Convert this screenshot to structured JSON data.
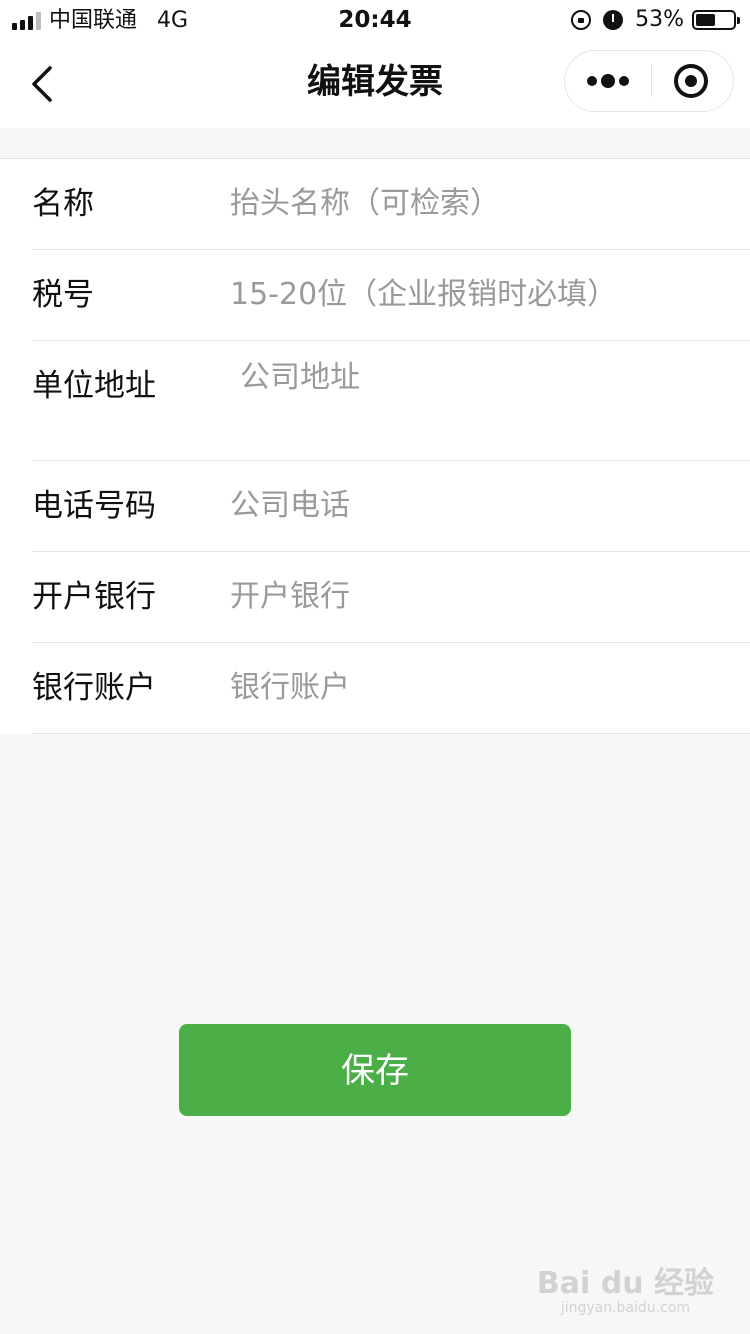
{
  "status_bar": {
    "carrier": "中国联通",
    "network": "4G",
    "time": "20:44",
    "battery": "53%",
    "battery_level": 0.53
  },
  "nav": {
    "title": "编辑发票",
    "back_icon": "chevron-left-icon",
    "more_icon": "more-dots-icon",
    "close_icon": "target-circle-icon"
  },
  "form": {
    "fields": [
      {
        "label": "名称",
        "placeholder": "抬头名称（可检索）"
      },
      {
        "label": "税号",
        "placeholder": "15-20位（企业报销时必填）"
      },
      {
        "label": "单位地址",
        "placeholder": "公司地址"
      },
      {
        "label": "电话号码",
        "placeholder": "公司电话"
      },
      {
        "label": "开户银行",
        "placeholder": "开户银行"
      },
      {
        "label": "银行账户",
        "placeholder": "银行账户"
      }
    ]
  },
  "save_button": {
    "label": "保存"
  },
  "watermark": {
    "logo": "Bai du 经验",
    "url": "jingyan.baidu.com"
  },
  "colors": {
    "accent": "#4cae47",
    "background": "#f7f7f7",
    "placeholder": "#9a9a9a"
  }
}
